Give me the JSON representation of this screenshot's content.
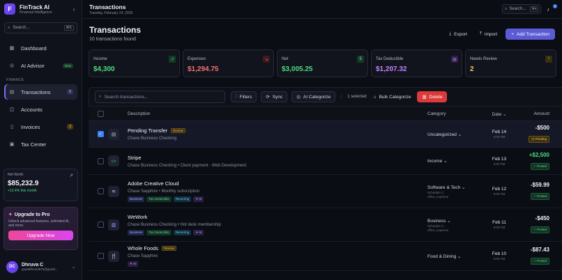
{
  "brand": {
    "name": "FinTrack AI",
    "subtitle": "Financial Intelligence",
    "logo_letter": "F"
  },
  "sidebar": {
    "search_placeholder": "Search...",
    "search_kbd": "⌘K",
    "items": [
      {
        "label": "Dashboard",
        "icon": "grid-icon"
      },
      {
        "label": "AI Advisor",
        "icon": "sparkle-icon",
        "badge": "New"
      }
    ],
    "section_finance": "FINANCE",
    "finance_items": [
      {
        "label": "Transactions",
        "icon": "receipt-icon",
        "count": "5",
        "active": true
      },
      {
        "label": "Accounts",
        "icon": "wallet-icon"
      },
      {
        "label": "Invoices",
        "icon": "file-icon",
        "count": "2"
      },
      {
        "label": "Tax Center",
        "icon": "calculator-icon"
      }
    ],
    "networth": {
      "label": "Net Worth",
      "value": "$85,232.9",
      "delta": "+12.4% this month"
    },
    "upgrade": {
      "title": "Upgrade to Pro",
      "desc": "Unlock advanced features, unlimited AI, and more.",
      "button": "Upgrade Now"
    },
    "user": {
      "initials": "DC",
      "name": "Dhruva C",
      "email": "gopaldhruv3675@gmail..."
    }
  },
  "topbar": {
    "title": "Transactions",
    "date": "Tuesday, February 24, 2026",
    "search": "Search...",
    "kbd": "⌘K",
    "notif_count": "1"
  },
  "header": {
    "title": "Transactions",
    "subtitle": "10 transactions found",
    "export": "Export",
    "import": "Import",
    "add": "Add Transaction"
  },
  "cards": [
    {
      "label": "Income",
      "value": "$4,300",
      "color": "#4ade80",
      "icon": "↗",
      "icon_bg": "#173a27"
    },
    {
      "label": "Expenses",
      "value": "$1,294.75",
      "color": "#f87171",
      "icon": "↘",
      "icon_bg": "#3e1a1d"
    },
    {
      "label": "Net",
      "value": "$3,005.25",
      "color": "#4ade80",
      "icon": "$",
      "icon_bg": "#173a27"
    },
    {
      "label": "Tax Deductible",
      "value": "$1,207.32",
      "color": "#c084fc",
      "icon": "▤",
      "icon_bg": "#2f1f46"
    },
    {
      "label": "Needs Review",
      "value": "2",
      "color": "#f5c45a",
      "icon": "!",
      "icon_bg": "#3b2e0f"
    }
  ],
  "toolbar": {
    "search_placeholder": "Search transactions...",
    "filters": "Filters",
    "sync": "Sync",
    "ai_categorize": "AI Categorize",
    "selected": "1 selected",
    "bulk": "Bulk Categorize",
    "delete": "Delete"
  },
  "table": {
    "headers": {
      "description": "Description",
      "category": "Category",
      "date": "Date",
      "amount": "Amount"
    },
    "rows": [
      {
        "name": "Pending Transfer",
        "review": "Review",
        "account": "Chase Business Checking",
        "note": "",
        "icon": "▤",
        "category": "Uncategorized",
        "cat_sub1": "",
        "cat_sub2": "",
        "date": "Feb 14",
        "time": "6:00 PM",
        "amount": "-$500",
        "status": "Pending",
        "selected": true,
        "tags": []
      },
      {
        "name": "Stripe",
        "review": "",
        "account": "Chase Business Checking",
        "note": "Client payment - Web Development",
        "icon": "▭",
        "icon_color": "#4ade80",
        "category": "Income",
        "cat_sub1": "",
        "cat_sub2": "",
        "date": "Feb 13",
        "time": "6:00 PM",
        "amount": "+$2,500",
        "status": "Posted",
        "positive": true,
        "tags": []
      },
      {
        "name": "Adobe Creative Cloud",
        "review": "",
        "account": "Chase Sapphire",
        "note": "Monthly subscription",
        "icon": "≋",
        "category": "Software & Tech",
        "cat_sub1": "Schedule C:",
        "cat_sub2": "office_expense",
        "date": "Feb 12",
        "time": "6:00 PM",
        "amount": "-$59.99",
        "status": "Posted",
        "tags": [
          "Business",
          "Tax Deductible",
          "Recurring",
          "AI"
        ]
      },
      {
        "name": "WeWork",
        "review": "",
        "account": "Chase Business Checking",
        "note": "Hot desk membership",
        "icon": "▥",
        "icon_color": "#93a5ff",
        "category": "Business",
        "cat_sub1": "Schedule C:",
        "cat_sub2": "office_expense",
        "date": "Feb 11",
        "time": "6:00 PM",
        "amount": "-$450",
        "status": "Posted",
        "tags": [
          "Business",
          "Tax Deductible",
          "Recurring",
          "AI"
        ]
      },
      {
        "name": "Whole Foods",
        "review": "Review",
        "account": "Chase Sapphire",
        "note": "",
        "icon": "🍴",
        "icon_color": "#fb923c",
        "category": "Food & Dining",
        "cat_sub1": "",
        "cat_sub2": "",
        "date": "Feb 10",
        "time": "6:00 PM",
        "amount": "-$87.43",
        "status": "Posted",
        "tags": [
          "AI"
        ]
      }
    ]
  }
}
